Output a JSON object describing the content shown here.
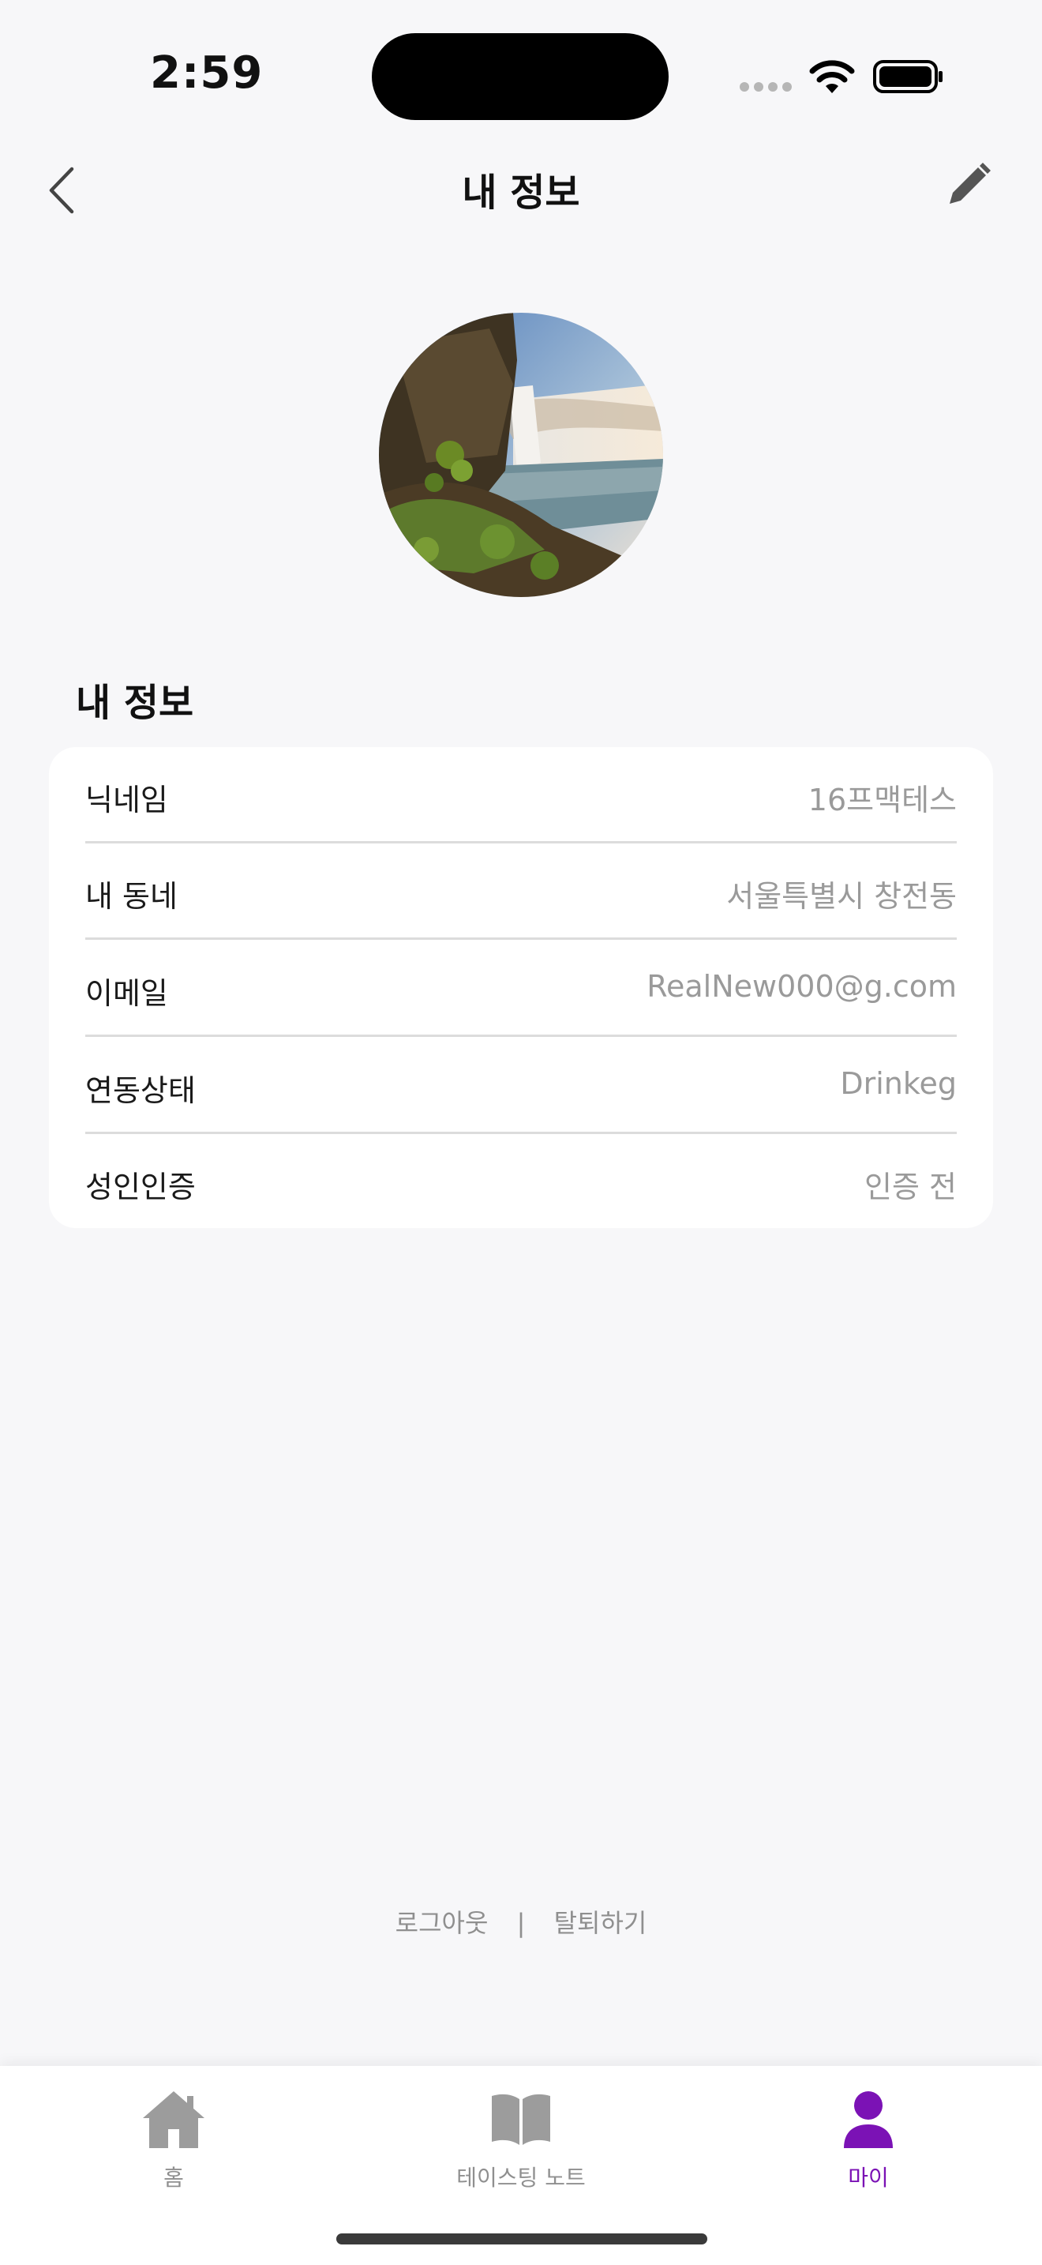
{
  "status_bar": {
    "time": "2:59"
  },
  "nav": {
    "title": "내 정보"
  },
  "section": {
    "title": "내 정보"
  },
  "info_rows": [
    {
      "label": "닉네임",
      "value": "16프맥테스"
    },
    {
      "label": "내 동네",
      "value": "서울특별시 창전동"
    },
    {
      "label": "이메일",
      "value": "RealNew000@g.com"
    },
    {
      "label": "연동상태",
      "value": "Drinkeg"
    },
    {
      "label": "성인인증",
      "value": "인증 전"
    }
  ],
  "footer": {
    "logout": "로그아웃",
    "separator": "|",
    "withdraw": "탈퇴하기"
  },
  "tabs": [
    {
      "label": "홈",
      "icon": "home-icon",
      "active": false
    },
    {
      "label": "테이스팅 노트",
      "icon": "book-icon",
      "active": false
    },
    {
      "label": "마이",
      "icon": "person-icon",
      "active": true
    }
  ],
  "colors": {
    "accent": "#7b12b5",
    "inactive": "#8f8f8f",
    "background": "#f7f7f9"
  }
}
